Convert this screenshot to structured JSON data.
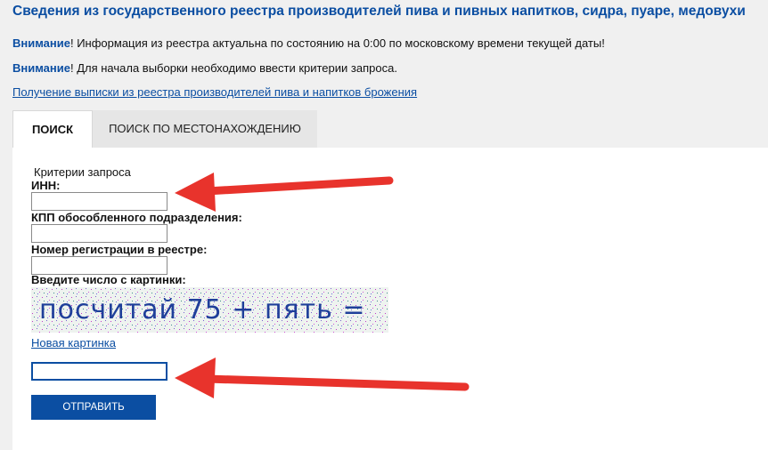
{
  "header": {
    "title": "Сведения из государственного реестра производителей пива и пивных напитков, сидра, пуаре, медовухи"
  },
  "notices": [
    {
      "label": "Внимание",
      "text": "! Информация из реестра актуальна по состоянию на 0:00 по московскому времени текущей даты!"
    },
    {
      "label": "Внимание",
      "text": "! Для начала выборки необходимо ввести критерии запроса."
    }
  ],
  "extract_link": "Получение выписки из реестра производителей пива и напитков брожения",
  "tabs": [
    {
      "label": "ПОИСК",
      "active": true
    },
    {
      "label": "ПОИСК ПО МЕСТОНАХОЖДЕНИЮ",
      "active": false
    }
  ],
  "form": {
    "criteria_title": "Критерии запроса",
    "inn_label": "ИНН:",
    "inn_value": "",
    "kpp_label": "КПП обособленного подразделения:",
    "kpp_value": "",
    "reg_label": "Номер регистрации в реестре:",
    "reg_value": "",
    "captcha_label": "Введите число с картинки:",
    "captcha_image_text": "посчитай 75 + пять =",
    "new_picture_link": "Новая картинка",
    "captcha_value": "",
    "submit_label": "ОТПРАВИТЬ"
  },
  "colors": {
    "brand": "#0b4ea2",
    "arrow": "#e8332c",
    "background": "#f0f0f0"
  }
}
